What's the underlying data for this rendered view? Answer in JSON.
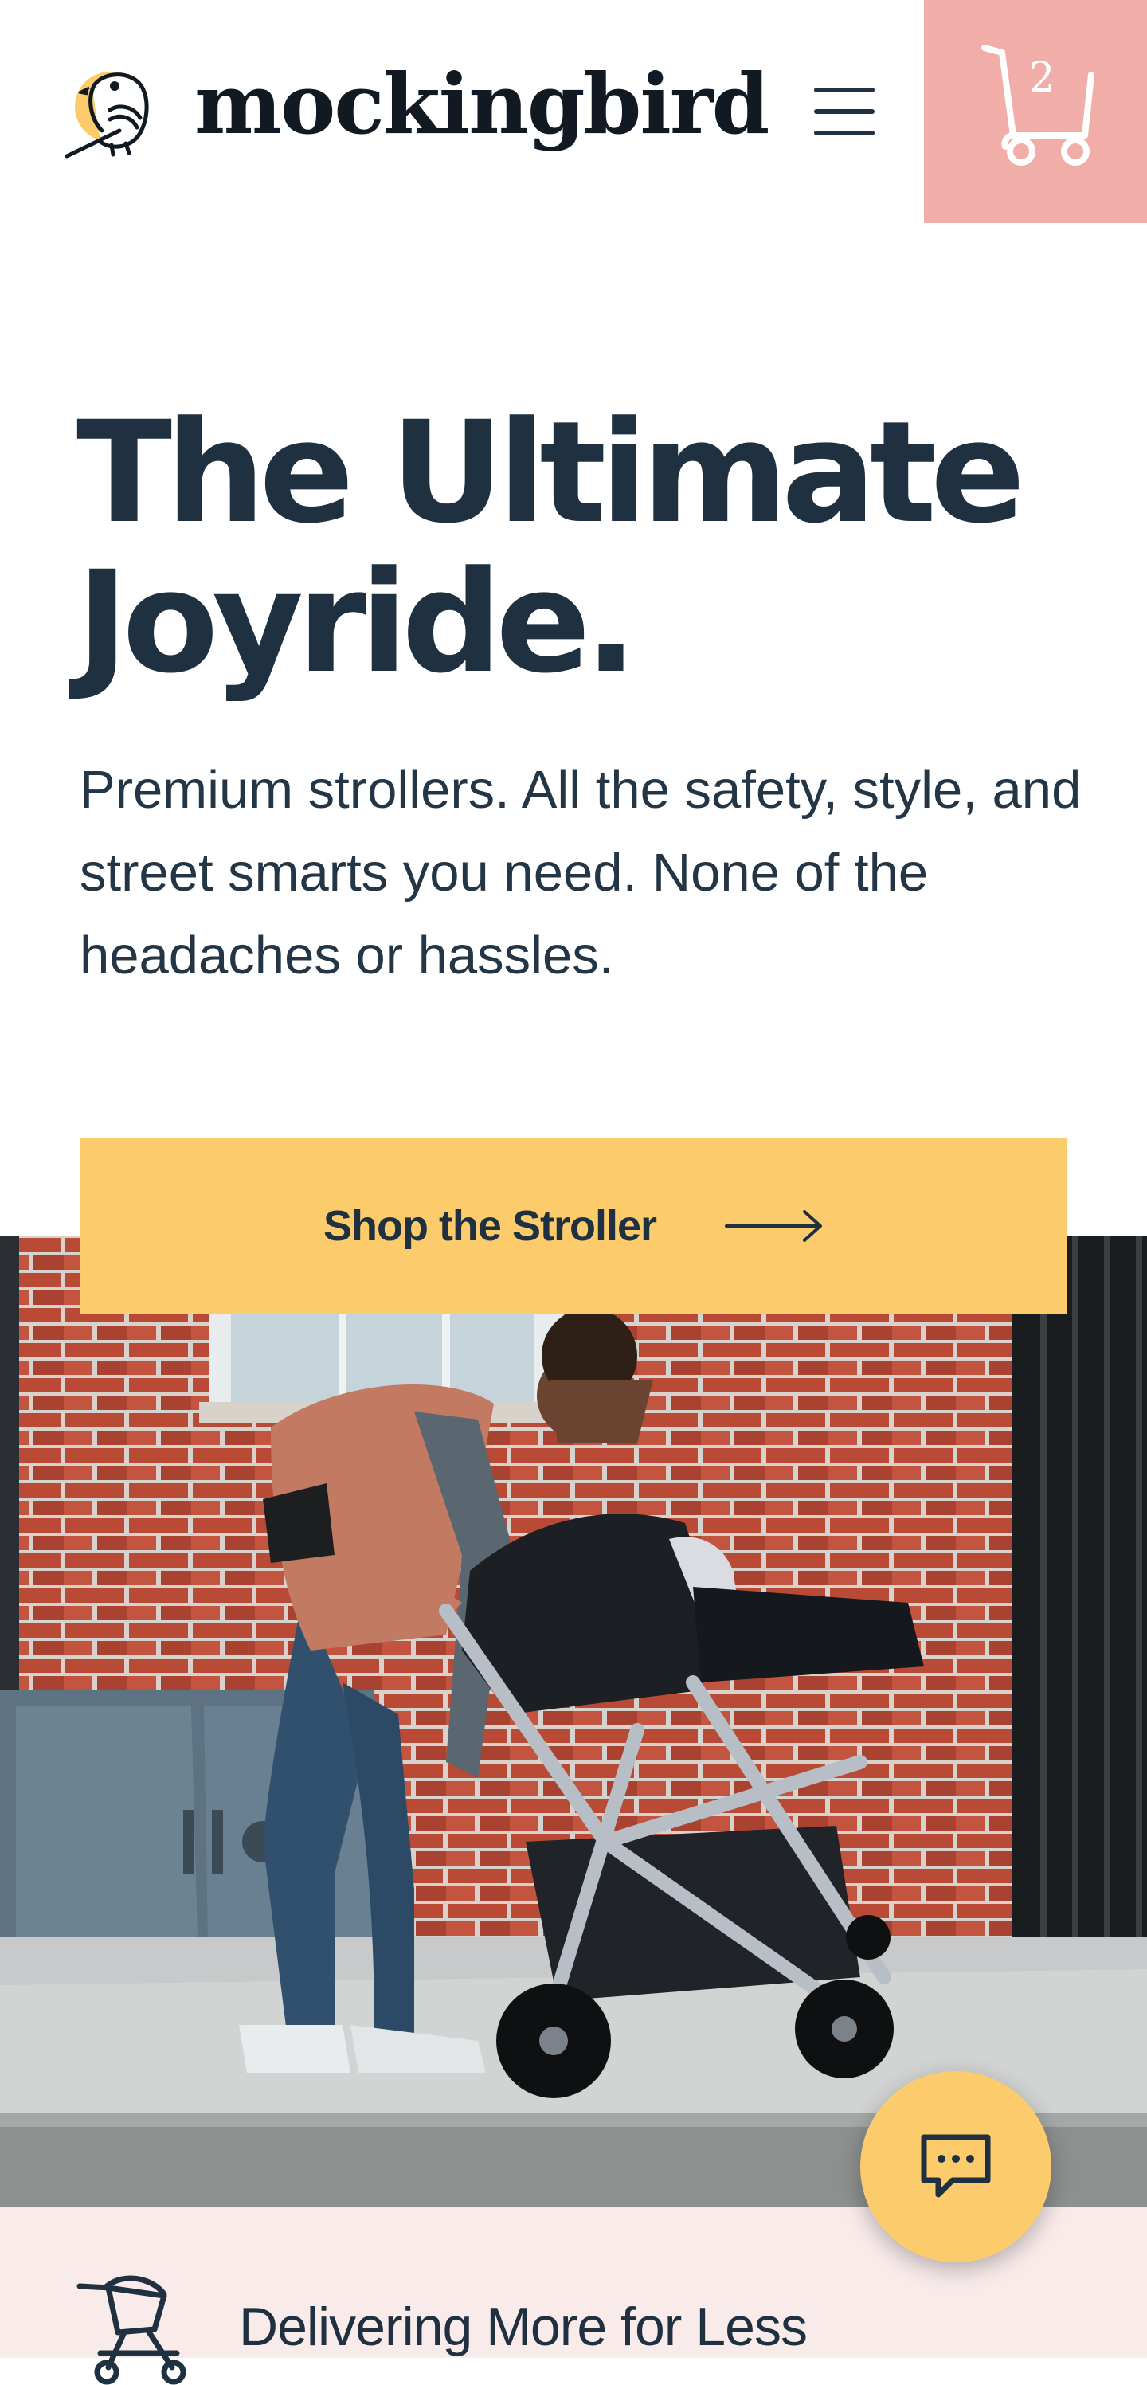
{
  "header": {
    "brand": "mockingbird",
    "menu_icon": "hamburger-menu-icon",
    "cart_icon": "shopping-cart-icon",
    "cart_count": "2",
    "cart_bg_color": "#f1aea8"
  },
  "hero": {
    "title": "The Ultimate Joyride.",
    "subtitle": "Premium strollers. All the safety, style, and street smarts you need. None of the headaches or hassles.",
    "cta_label": "Shop the Stroller",
    "cta_icon": "arrow-right-icon",
    "cta_color": "#fccc6c",
    "image_description_icon": "hero-photo"
  },
  "feature": {
    "icon": "stroller-icon",
    "title": "Delivering More for Less",
    "bg_color": "#f8ebea"
  },
  "chat": {
    "icon": "chat-bubble-icon"
  },
  "colors": {
    "navy": "#1f3140",
    "yellow": "#fccc6c",
    "pink": "#f1aea8"
  }
}
